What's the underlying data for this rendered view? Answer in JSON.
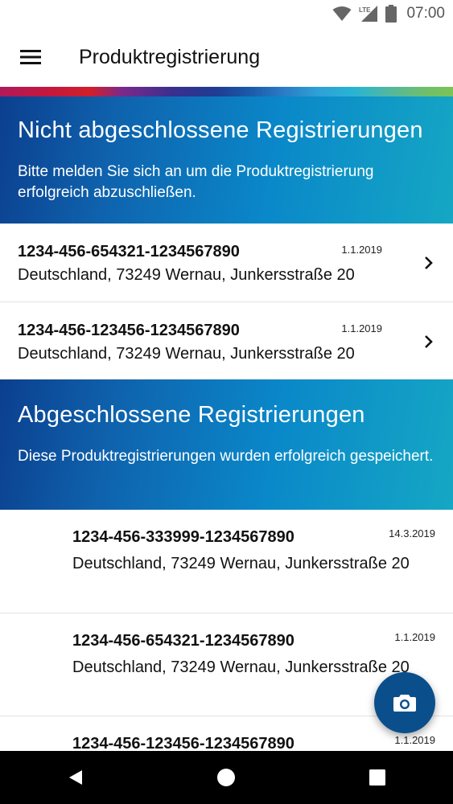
{
  "status_bar": {
    "network_label": "LTE",
    "time": "07:00",
    "icons": [
      "wifi-icon",
      "lte-signal-icon",
      "battery-icon"
    ]
  },
  "app_bar": {
    "menu_icon": "hamburger-menu-icon",
    "title": "Produktregistrierung"
  },
  "colors": {
    "primary": "#0a4f8c",
    "header_gradient_start": "#0b3f8e",
    "header_gradient_end": "#15a7c4"
  },
  "pending": {
    "title": "Nicht abgeschlossene Registrierungen",
    "subtitle": "Bitte melden Sie sich an um die Produktregistrierung erfolgreich abzuschließen.",
    "items": [
      {
        "code": "1234-456-654321-1234567890",
        "date": "1.1.2019",
        "address": "Deutschland, 73249 Wernau, Junkersstraße 20"
      },
      {
        "code": "1234-456-123456-1234567890",
        "date": "1.1.2019",
        "address": "Deutschland, 73249 Wernau, Junkersstraße 20"
      }
    ]
  },
  "completed": {
    "title": "Abgeschlossene Registrierungen",
    "subtitle": "Diese Produktregistrierungen wurden erfolgreich gespeichert.",
    "items": [
      {
        "code": "1234-456-333999-1234567890",
        "date": "14.3.2019",
        "address": "Deutschland, 73249 Wernau, Junkersstraße 20"
      },
      {
        "code": "1234-456-654321-1234567890",
        "date": "1.1.2019",
        "address": "Deutschland, 73249 Wernau, Junkersstraße 20"
      },
      {
        "code": "1234-456-123456-1234567890",
        "date": "1.1.2019",
        "address": ""
      }
    ]
  },
  "fab": {
    "icon": "camera-icon"
  },
  "nav_bar": {
    "icons": [
      "back-icon",
      "home-icon",
      "recents-icon"
    ]
  }
}
